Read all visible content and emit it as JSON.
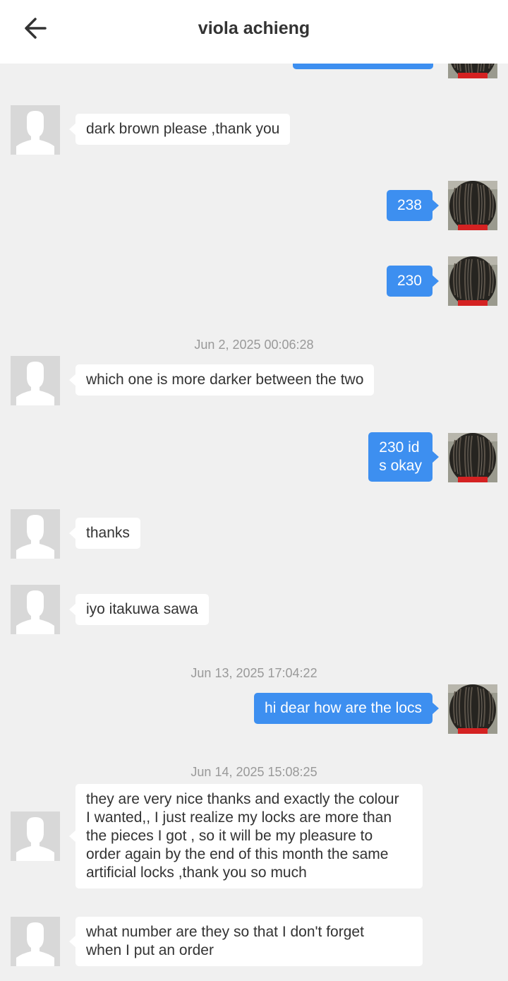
{
  "header": {
    "title": "viola achieng",
    "back_icon": "arrow-left-icon"
  },
  "colors": {
    "outgoing_bubble": "#3d8ff0",
    "incoming_bubble": "#ffffff",
    "background": "#f0f0f0",
    "timestamp": "#999999"
  },
  "messages": {
    "m1": "dark brown please ,thank you",
    "m2": "238",
    "m3": "230",
    "t1": "Jun 2, 2025 00:06:28",
    "m4": "which one is more darker between the two",
    "m5_line1": "230 id",
    "m5_line2": "s okay",
    "m6": "thanks",
    "m7": "iyo itakuwa sawa",
    "t2": "Jun 13, 2025 17:04:22",
    "m8": "hi dear how are the locs",
    "t3": "Jun 14, 2025 15:08:25",
    "m9_line1": "they are very nice thanks and exactly the colour",
    "m9_line2": "I wanted,, I just realize my locks are more than",
    "m9_line3": "the pieces I got , so it will be my pleasure to",
    "m9_line4": "order again by the end of this month the same",
    "m9_line5": "artificial locks ,thank you so much",
    "m10_line1": "what number are they so that I don't forget",
    "m10_line2": "when I put an order"
  }
}
